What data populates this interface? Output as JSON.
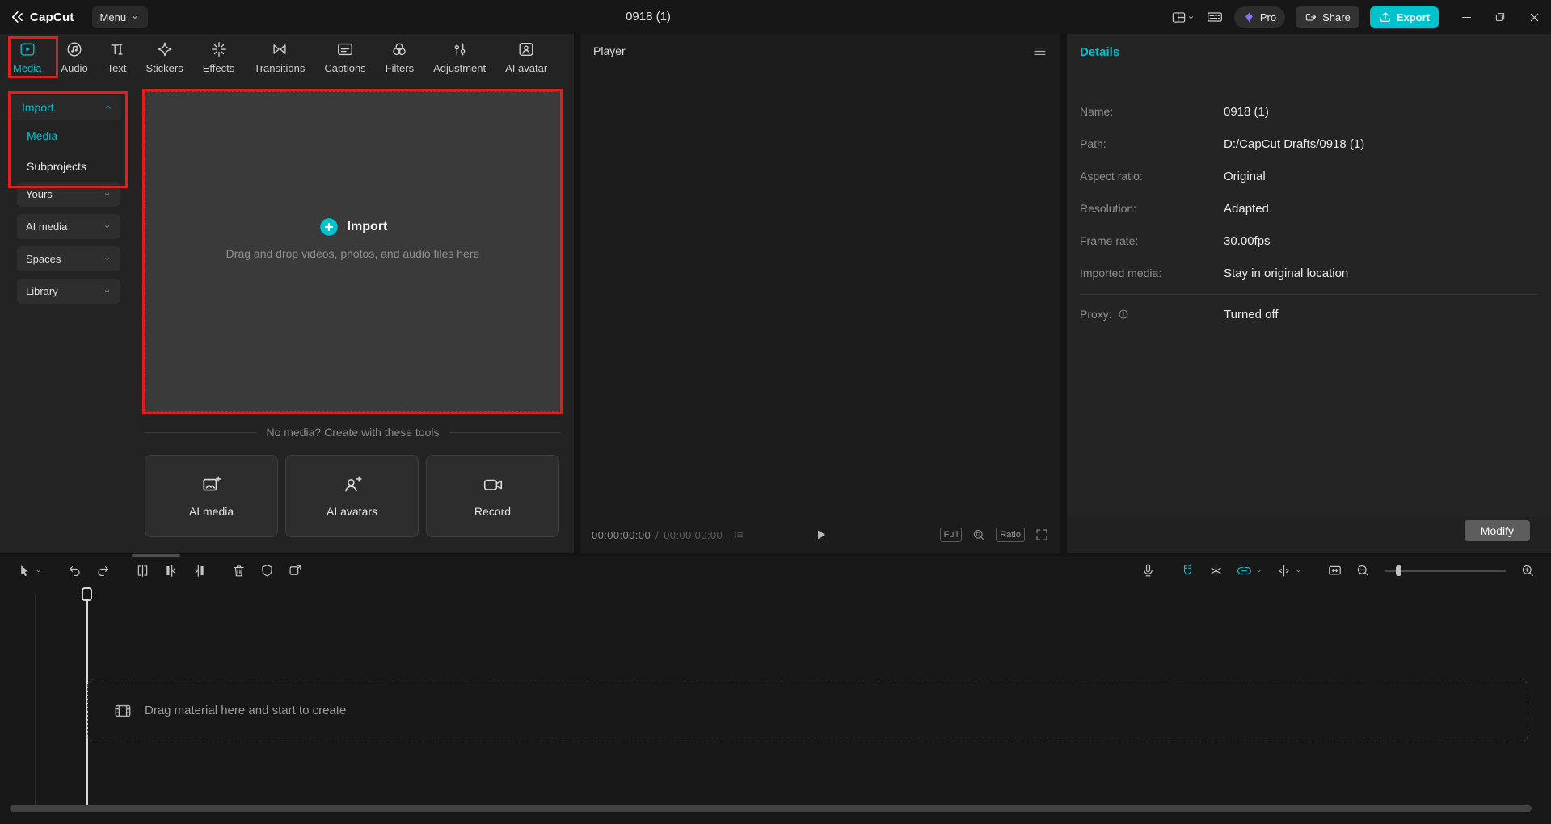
{
  "colors": {
    "accent": "#00c2cc",
    "annotation_red": "#e31c1c"
  },
  "titlebar": {
    "app_name": "CapCut",
    "menu_label": "Menu",
    "document_title": "0918 (1)",
    "pro_label": "Pro",
    "share_label": "Share",
    "export_label": "Export"
  },
  "tabs": [
    {
      "label": "Media"
    },
    {
      "label": "Audio"
    },
    {
      "label": "Text"
    },
    {
      "label": "Stickers"
    },
    {
      "label": "Effects"
    },
    {
      "label": "Transitions"
    },
    {
      "label": "Captions"
    },
    {
      "label": "Filters"
    },
    {
      "label": "Adjustment"
    },
    {
      "label": "AI avatar"
    }
  ],
  "sidebar": {
    "import_label": "Import",
    "media_label": "Media",
    "subprojects_label": "Subprojects",
    "yours_label": "Yours",
    "ai_media_label": "AI media",
    "spaces_label": "Spaces",
    "library_label": "Library"
  },
  "import_panel": {
    "import_title": "Import",
    "import_hint": "Drag and drop videos, photos, and audio files here",
    "tools_divider": "No media? Create with these tools",
    "tool_ai_media": "AI media",
    "tool_ai_avatars": "AI avatars",
    "tool_record": "Record"
  },
  "player": {
    "title": "Player",
    "current_time": "00:00:00:00",
    "separator": "/",
    "total_time": "00:00:00:00",
    "full_label": "Full",
    "ratio_label": "Ratio"
  },
  "details": {
    "title": "Details",
    "rows": [
      {
        "label": "Name:",
        "value": "0918 (1)"
      },
      {
        "label": "Path:",
        "value": "D:/CapCut Drafts/0918 (1)"
      },
      {
        "label": "Aspect ratio:",
        "value": "Original"
      },
      {
        "label": "Resolution:",
        "value": "Adapted"
      },
      {
        "label": "Frame rate:",
        "value": "30.00fps"
      },
      {
        "label": "Imported media:",
        "value": "Stay in original location"
      }
    ],
    "proxy_label": "Proxy:",
    "proxy_value": "Turned off",
    "modify_label": "Modify"
  },
  "timeline": {
    "drop_hint": "Drag material here and start to create"
  }
}
